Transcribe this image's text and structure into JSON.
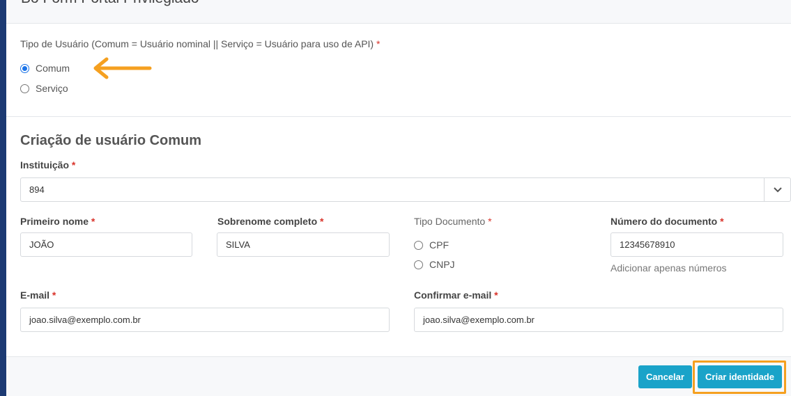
{
  "modal": {
    "title": "Bo Form Portal Privilegiado"
  },
  "user_type": {
    "question": "Tipo de Usuário (Comum = Usuário nominal || Serviço = Usuário para uso de API)",
    "required_mark": "*",
    "options": [
      {
        "label": "Comum",
        "selected": true
      },
      {
        "label": "Serviço",
        "selected": false
      }
    ]
  },
  "form": {
    "heading": "Criação de usuário Comum",
    "institution": {
      "label": "Instituição",
      "value": "894"
    },
    "first_name": {
      "label": "Primeiro nome",
      "value": "JOÃO"
    },
    "last_name": {
      "label": "Sobrenome completo",
      "value": "SILVA"
    },
    "doc_type": {
      "label": "Tipo Documento",
      "options": [
        {
          "label": "CPF",
          "selected": false
        },
        {
          "label": "CNPJ",
          "selected": false
        }
      ]
    },
    "doc_number": {
      "label": "Número do documento",
      "value": "12345678910",
      "help": "Adicionar apenas números"
    },
    "email": {
      "label": "E-mail",
      "value": "joao.silva@exemplo.com.br"
    },
    "confirm_email": {
      "label": "Confirmar e-mail",
      "value": "joao.silva@exemplo.com.br"
    }
  },
  "footer": {
    "cancel_label": "Cancelar",
    "create_label": "Criar identidade"
  },
  "colors": {
    "accent_button": "#1aa3c9",
    "annotation": "#f5a020",
    "required": "#d9342b",
    "radio_checked": "#1a73e8"
  },
  "icons": {
    "select_toggle": "chevron-down-icon",
    "annotation": "arrow-left-icon"
  }
}
